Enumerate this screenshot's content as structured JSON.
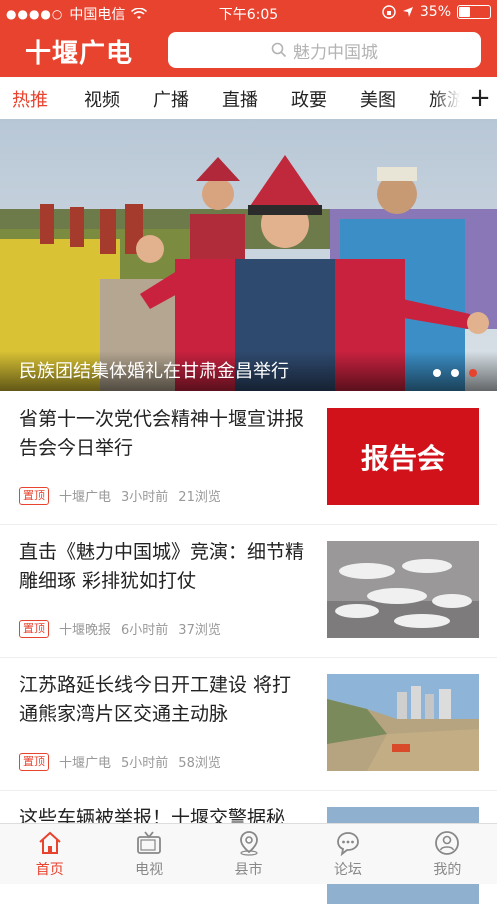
{
  "status": {
    "carrier": "中国电信",
    "time": "下午6:05",
    "battery": "35%",
    "battery_level": 0.35
  },
  "header": {
    "logo": "十堰广电",
    "search_placeholder": "魅力中国城"
  },
  "tabs": [
    {
      "label": "热推",
      "active": true
    },
    {
      "label": "视频"
    },
    {
      "label": "广播"
    },
    {
      "label": "直播"
    },
    {
      "label": "政要"
    },
    {
      "label": "美图"
    },
    {
      "label": "旅游"
    }
  ],
  "add_tab": "+",
  "banner": {
    "caption": "民族团结集体婚礼在甘肃金昌举行",
    "slides": 3,
    "current": 3
  },
  "news": [
    {
      "title": "省第十一次党代会精神十堰宣讲报告会今日举行",
      "tag": "置顶",
      "source": "十堰广电",
      "time": "3小时前",
      "views": "21浏览",
      "thumb_text": "报告会"
    },
    {
      "title": "直击《魅力中国城》竞演：细节精雕细琢 彩排犹如打仗",
      "tag": "置顶",
      "source": "十堰晚报",
      "time": "6小时前",
      "views": "37浏览"
    },
    {
      "title": "江苏路延长线今日开工建设 将打通熊家湾片区交通主动脉",
      "tag": "置顶",
      "source": "十堰广电",
      "time": "5小时前",
      "views": "58浏览"
    },
    {
      "title": "这些车辆被举报！十堰交警据秘"
    }
  ],
  "tabbar": [
    {
      "label": "首页",
      "icon": "home-icon",
      "active": true
    },
    {
      "label": "电视",
      "icon": "tv-icon"
    },
    {
      "label": "县市",
      "icon": "location-icon"
    },
    {
      "label": "论坛",
      "icon": "chat-icon"
    },
    {
      "label": "我的",
      "icon": "user-icon"
    }
  ],
  "colors": {
    "brand": "#e8432f"
  }
}
